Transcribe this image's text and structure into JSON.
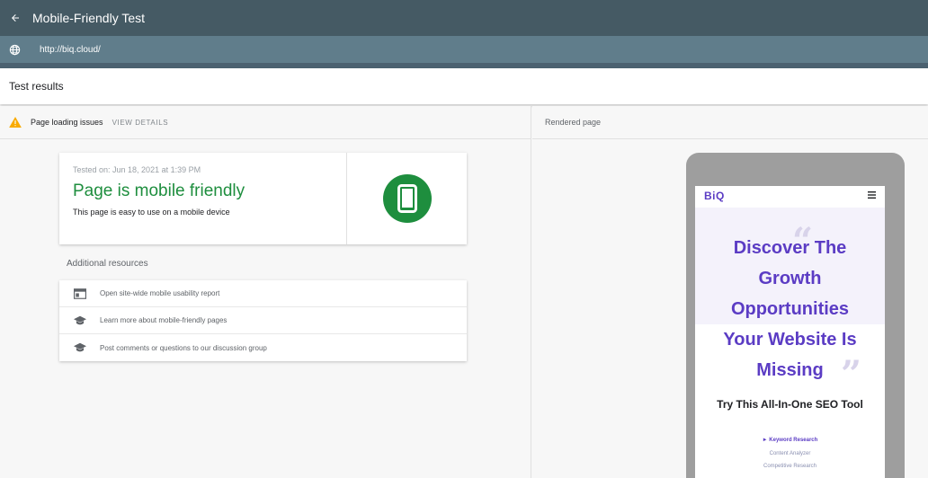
{
  "topbar": {
    "title": "Mobile-Friendly Test",
    "back_icon": "arrow-left-icon"
  },
  "urlbar": {
    "url": "http://biq.cloud/",
    "globe_icon": "globe-icon"
  },
  "results": {
    "title": "Test results"
  },
  "issues": {
    "label": "Page loading issues",
    "view_details": "VIEW DETAILS",
    "icon": "warning-icon",
    "icon_color": "#f9ab00"
  },
  "result_card": {
    "tested_on": "Tested on: Jun 18, 2021 at 1:39 PM",
    "verdict": "Page is mobile friendly",
    "verdict_sub": "This page is easy to use on a mobile device",
    "verdict_color": "#1e8e3e",
    "icon": "smartphone-icon"
  },
  "additional": {
    "title": "Additional resources",
    "items": [
      {
        "label": "Open site-wide mobile usability report",
        "icon": "report-icon"
      },
      {
        "label": "Learn more about mobile-friendly pages",
        "icon": "graduation-cap-icon"
      },
      {
        "label": "Post comments or questions to our discussion group",
        "icon": "graduation-cap-icon"
      }
    ]
  },
  "rendered": {
    "label": "Rendered page",
    "site": {
      "logo": "BiQ",
      "hero_lines": [
        "Discover The",
        "Growth",
        "Opportunities",
        "Your Website Is",
        "Missing"
      ],
      "tagline": "Try This All-In-One SEO Tool",
      "menu": [
        {
          "label": "► Keyword Research",
          "active": true
        },
        {
          "label": "Content Analyzer",
          "active": false
        },
        {
          "label": "Competitive Research",
          "active": false
        }
      ],
      "brand_color": "#5b3cc4"
    }
  }
}
